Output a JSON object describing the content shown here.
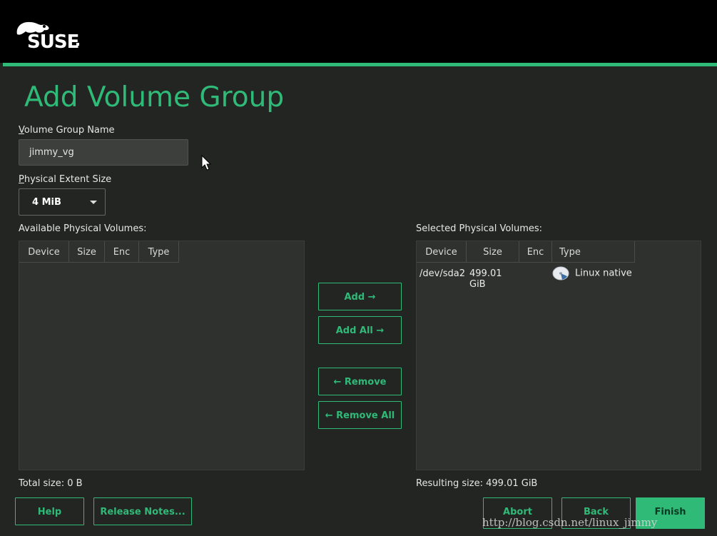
{
  "brand": {
    "logo_text": "SUSE"
  },
  "page": {
    "title": "Add Volume Group"
  },
  "vg_name": {
    "label": "Volume Group Name",
    "value": "jimmy_vg"
  },
  "extent": {
    "label": "Physical Extent Size",
    "value": "4 MiB"
  },
  "available": {
    "label": "Available Physical Volumes:",
    "columns": [
      "Device",
      "Size",
      "Enc",
      "Type"
    ],
    "rows": [],
    "total": "Total size: 0 B"
  },
  "selected": {
    "label": "Selected Physical Volumes:",
    "columns": [
      "Device",
      "Size",
      "Enc",
      "Type"
    ],
    "rows": [
      {
        "device": "/dev/sda2",
        "size": "499.01 GiB",
        "enc": "",
        "type": "Linux native",
        "icon": "disk-icon"
      }
    ],
    "total": "Resulting size: 499.01 GiB"
  },
  "buttons": {
    "add": "Add →",
    "add_all": "Add All →",
    "remove": "← Remove",
    "remove_all": "← Remove All",
    "help": "Help",
    "release_notes": "Release Notes...",
    "abort": "Abort",
    "back": "Back",
    "finish": "Finish"
  },
  "watermark": "http://blog.csdn.net/linux_jimmy",
  "colors": {
    "accent": "#30ba78",
    "background": "#232523",
    "header": "#000000"
  }
}
